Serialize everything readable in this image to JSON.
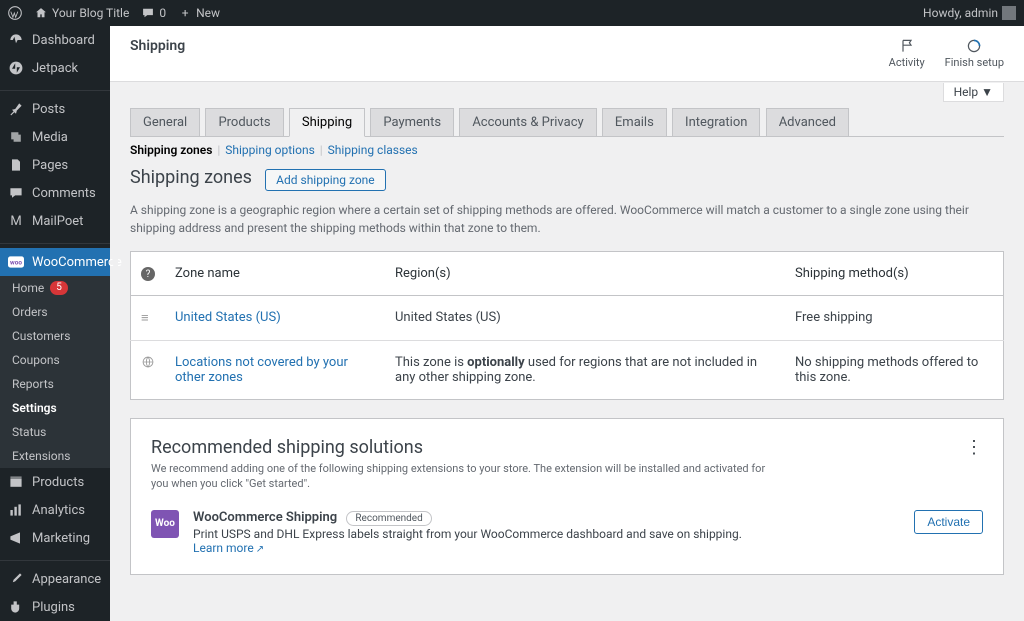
{
  "adminbar": {
    "site_title": "Your Blog Title",
    "comments_count": "0",
    "new_label": "New",
    "howdy": "Howdy, admin"
  },
  "sidebar": {
    "items": [
      {
        "label": "Dashboard"
      },
      {
        "label": "Jetpack"
      },
      {
        "label": "Posts"
      },
      {
        "label": "Media"
      },
      {
        "label": "Pages"
      },
      {
        "label": "Comments"
      },
      {
        "label": "MailPoet"
      },
      {
        "label": "WooCommerce"
      },
      {
        "label": "Products"
      },
      {
        "label": "Analytics"
      },
      {
        "label": "Marketing"
      },
      {
        "label": "Appearance"
      },
      {
        "label": "Plugins"
      }
    ],
    "woo_submenu": [
      {
        "label": "Home",
        "badge": "5"
      },
      {
        "label": "Orders"
      },
      {
        "label": "Customers"
      },
      {
        "label": "Coupons"
      },
      {
        "label": "Reports"
      },
      {
        "label": "Settings"
      },
      {
        "label": "Status"
      },
      {
        "label": "Extensions"
      }
    ]
  },
  "header": {
    "title": "Shipping",
    "activity": "Activity",
    "finish": "Finish setup",
    "help": "Help ▼"
  },
  "tabs": [
    "General",
    "Products",
    "Shipping",
    "Payments",
    "Accounts & Privacy",
    "Emails",
    "Integration",
    "Advanced"
  ],
  "subsub": {
    "zones": "Shipping zones",
    "options": "Shipping options",
    "classes": "Shipping classes"
  },
  "section": {
    "title": "Shipping zones",
    "add_button": "Add shipping zone",
    "description": "A shipping zone is a geographic region where a certain set of shipping methods are offered. WooCommerce will match a customer to a single zone using their shipping address and present the shipping methods within that zone to them."
  },
  "table": {
    "headers": {
      "name": "Zone name",
      "region": "Region(s)",
      "methods": "Shipping method(s)"
    },
    "rows": [
      {
        "name": "United States (US)",
        "region": "United States (US)",
        "methods": "Free shipping"
      }
    ],
    "rest": {
      "name": "Locations not covered by your other zones",
      "region_prefix": "This zone is ",
      "region_bold": "optionally",
      "region_suffix": " used for regions that are not included in any other shipping zone.",
      "methods": "No shipping methods offered to this zone."
    }
  },
  "rec": {
    "title": "Recommended shipping solutions",
    "sub": "We recommend adding one of the following shipping extensions to your store. The extension will be installed and activated for you when you click \"Get started\".",
    "item": {
      "title": "WooCommerce Shipping",
      "tag": "Recommended",
      "desc": "Print USPS and DHL Express labels straight from your WooCommerce dashboard and save on shipping.",
      "learn": "Learn more",
      "activate": "Activate"
    }
  }
}
